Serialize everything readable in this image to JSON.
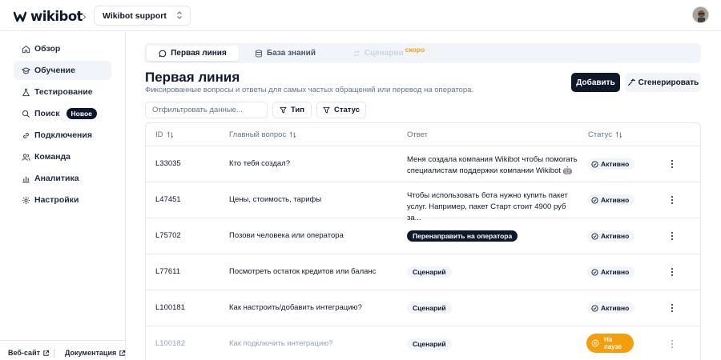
{
  "app": {
    "logo_text": "wikibot",
    "workspace": "Wikibot support"
  },
  "sidebar": {
    "items": [
      {
        "label": "Обзор",
        "icon": "home-icon"
      },
      {
        "label": "Обучение",
        "icon": "graduation-cap-icon",
        "active": true
      },
      {
        "label": "Тестирование",
        "icon": "flask-icon"
      },
      {
        "label": "Поиск",
        "icon": "search-icon",
        "badge": "Новое"
      },
      {
        "label": "Подключения",
        "icon": "link-icon"
      },
      {
        "label": "Команда",
        "icon": "users-icon"
      },
      {
        "label": "Аналитика",
        "icon": "chart-icon"
      },
      {
        "label": "Настройки",
        "icon": "gear-icon"
      }
    ],
    "footer": {
      "website": "Веб-сайт",
      "docs": "Документация"
    }
  },
  "tabs": [
    {
      "label": "Первая линия",
      "icon": "chat-icon",
      "active": true
    },
    {
      "label": "База знаний",
      "icon": "database-icon"
    },
    {
      "label": "Сценарии",
      "icon": "workflow-icon",
      "disabled": true,
      "badge": "скоро"
    }
  ],
  "page": {
    "title": "Первая линия",
    "subtitle": "Фиксированные вопросы и ответы для самых частых обращений или перевод на оператора.",
    "add_button": "Добавить",
    "generate_button": "Сгенерировать"
  },
  "filters": {
    "placeholder": "Отфильтровать данные...",
    "type_label": "Тип",
    "status_label": "Статус"
  },
  "table": {
    "headers": {
      "id": "ID",
      "question": "Главный вопрос",
      "answer": "Ответ",
      "status": "Статус"
    },
    "rows": [
      {
        "id": "L33035",
        "question": "Кто тебя создал?",
        "answer_line1": "Меня создала компания Wikibot чтобы помогать",
        "answer_line2": "специалистам поддержки компании Wikibot 🤖",
        "status": "Активно"
      },
      {
        "id": "L47451",
        "question": "Цены, стоимость, тарифы",
        "answer_line1": "Чтобы использовать бота нужно купить пакет",
        "answer_line2": "услуг. Например, пакет Старт стоит 4900 руб за...",
        "status": "Активно"
      },
      {
        "id": "L75702",
        "question": "Позови человека или оператора",
        "answer_tag": "Перенаправить на оператора",
        "status": "Активно"
      },
      {
        "id": "L77611",
        "question": "Посмотреть остаток кредитов или баланс",
        "answer_tag": "Сценарий",
        "status": "Активно"
      },
      {
        "id": "L100181",
        "question": "Как настроить/добавить интеграцию?",
        "answer_tag": "Сценарий",
        "status": "Активно"
      },
      {
        "id": "L100182",
        "question": "Как подключить интеграцию?",
        "answer_tag": "Сценарий",
        "status_line1": "На",
        "status_line2": "паузе"
      }
    ]
  },
  "colors": {
    "primary": "#0f172a",
    "paused": "#f59e0b",
    "muted": "#94a3b8"
  }
}
